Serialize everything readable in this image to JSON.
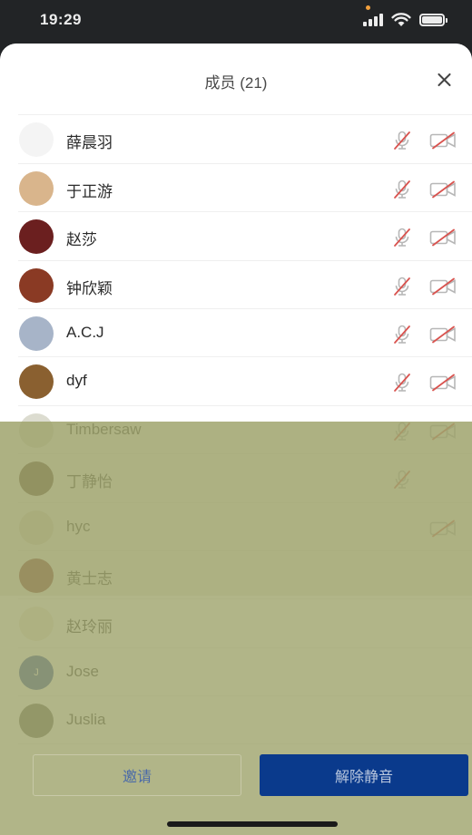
{
  "status_bar": {
    "time": "19:29"
  },
  "panel": {
    "title": "成员 (21)"
  },
  "members": [
    {
      "name": "",
      "avatar_color": "#3a7cf0",
      "mic": true,
      "cam": true
    },
    {
      "name": "薛晨羽",
      "avatar_color": "#f4f4f4",
      "mic": true,
      "cam": true
    },
    {
      "name": "于正游",
      "avatar_color": "#d9b58c",
      "mic": true,
      "cam": true
    },
    {
      "name": "赵莎",
      "avatar_color": "#6b1f1f",
      "mic": true,
      "cam": true
    },
    {
      "name": "钟欣颖",
      "avatar_color": "#8a3a24",
      "mic": true,
      "cam": true
    },
    {
      "name": "A.C.J",
      "avatar_color": "#a7b4c8",
      "mic": true,
      "cam": true
    },
    {
      "name": "dyf",
      "avatar_color": "#8a6030",
      "mic": true,
      "cam": true
    },
    {
      "name": "Timbersaw",
      "avatar_color": "#dcdcd0",
      "mic": true,
      "cam": true
    },
    {
      "name": "丁静怡",
      "avatar_color": "#4a3020",
      "mic": true,
      "cam": false
    },
    {
      "name": "hyc",
      "avatar_color": "#e6e0d0",
      "mic": false,
      "cam": true
    },
    {
      "name": "黄士志",
      "avatar_color": "#7a2018",
      "mic": false,
      "cam": false
    },
    {
      "name": "赵玲丽",
      "avatar_color": "#efe9d8",
      "mic": false,
      "cam": false
    },
    {
      "name": "Jose",
      "avatar_color": "#1b3e9a",
      "avatar_initial": "J",
      "mic": false,
      "cam": false
    },
    {
      "name": "Juslia",
      "avatar_color": "#5a5a50",
      "mic": false,
      "cam": false
    }
  ],
  "actions": {
    "invite_label": "邀请",
    "unmute_label": "解除静音"
  },
  "colors": {
    "primary": "#0a3a8c",
    "icon_muted": "#d9534f",
    "overlay": "#a0a56e"
  }
}
